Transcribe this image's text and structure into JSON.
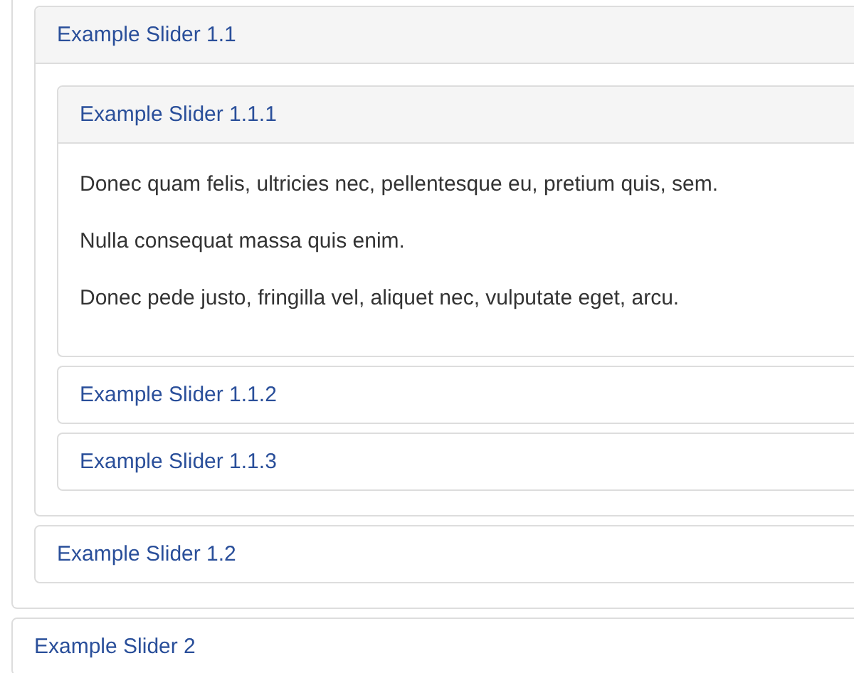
{
  "accordion": [
    {
      "expanded": true,
      "children": [
        {
          "title": "Example Slider 1.1",
          "expanded": true,
          "children": [
            {
              "title": "Example Slider 1.1.1",
              "expanded": true,
              "paragraphs": [
                "Donec quam felis, ultricies nec, pellentesque eu, pretium quis, sem.",
                "Nulla consequat massa quis enim.",
                "Donec pede justo, fringilla vel, aliquet nec, vulputate eget, arcu."
              ]
            },
            {
              "title": "Example Slider 1.1.2",
              "expanded": false
            },
            {
              "title": "Example Slider 1.1.3",
              "expanded": false
            }
          ]
        },
        {
          "title": "Example Slider 1.2",
          "expanded": false
        }
      ]
    },
    {
      "title": "Example Slider 2",
      "expanded": false
    }
  ]
}
